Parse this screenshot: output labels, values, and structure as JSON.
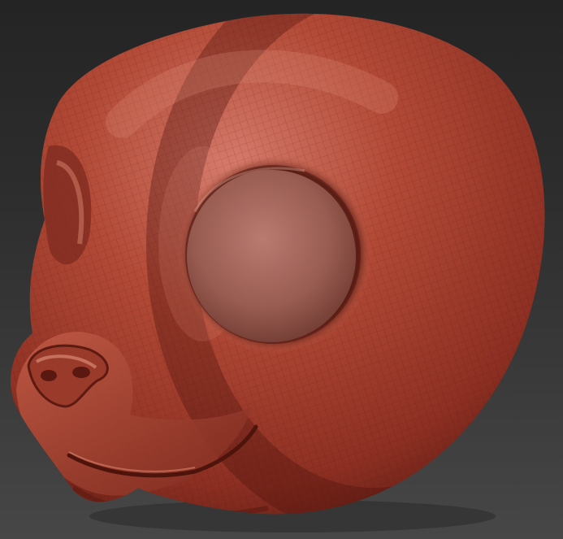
{
  "viewport": {
    "background_top": "#242424",
    "background_bottom": "#474747"
  },
  "model": {
    "subject": "sculpted-head-icon",
    "material_color": "#b04530",
    "highlight_color": "#d9826e",
    "shadow_color": "#5a1a12",
    "wireframe_visible": true
  }
}
